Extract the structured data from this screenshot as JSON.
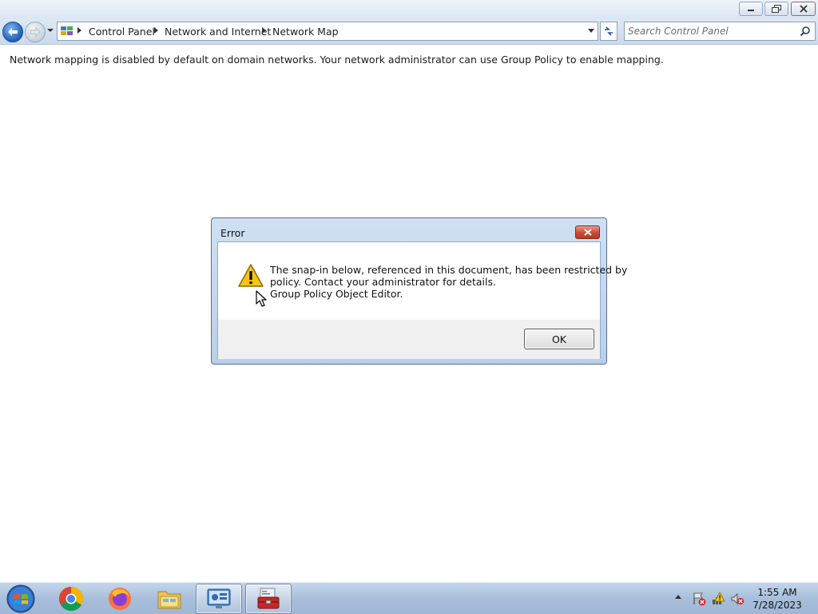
{
  "window": {
    "caption_buttons": {
      "minimize_icon": "minimize-icon",
      "restore_icon": "restore-icon",
      "close_icon": "close-icon"
    }
  },
  "navbar": {
    "breadcrumbs": [
      "Control Panel",
      "Network and Internet",
      "Network Map"
    ],
    "search": {
      "placeholder": "Search Control Panel",
      "value": ""
    }
  },
  "content": {
    "info_text": "Network mapping is disabled by default on domain networks. Your network administrator can use Group Policy to enable mapping."
  },
  "dialog": {
    "title": "Error",
    "message_line1": "The snap-in below, referenced in this document, has been restricted by",
    "message_line2": "policy. Contact your administrator for details.",
    "message_line3": "Group Policy Object Editor.",
    "ok_label": "OK",
    "icon": "warning-icon"
  },
  "taskbar": {
    "apps": [
      "Google Chrome",
      "Firefox",
      "Windows Explorer",
      "Control Panel",
      "Toolbox"
    ],
    "active_apps": [
      "Control Panel",
      "Toolbox"
    ],
    "tray_icons": [
      "action-center-icon",
      "network-icon",
      "volume-muted-icon"
    ],
    "clock": {
      "time": "1:55 AM",
      "date": "7/28/2023"
    }
  },
  "colors": {
    "accent": "#1f5fb7",
    "dialog_frame": "#b9cfe9",
    "close_red": "#c94b35",
    "taskbar": "#a8bfdb"
  }
}
